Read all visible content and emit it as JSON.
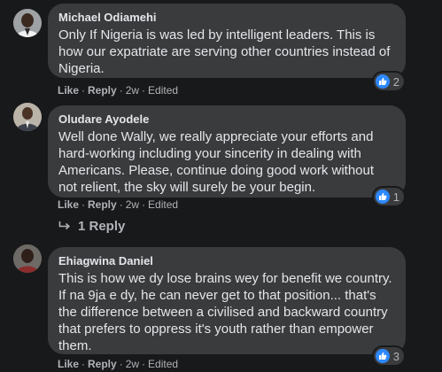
{
  "comments": [
    {
      "author": "Michael Odiamehi",
      "text": "Only If Nigeria is was led by intelligent leaders. This is how our expatriate are serving other countries instead of Nigeria.",
      "actions": {
        "like": "Like",
        "reply": "Reply",
        "time": "2w",
        "edited": "Edited"
      },
      "reaction_count": "2",
      "avatar_icon": "profile-photo"
    },
    {
      "author": "Oludare Ayodele",
      "text": "Well done Wally, we really appreciate your efforts and hard-working including your sincerity in dealing with Americans. Please, continue doing good work without not relient, the sky will surely be your begin.",
      "actions": {
        "like": "Like",
        "reply": "Reply",
        "time": "2w",
        "edited": "Edited"
      },
      "reaction_count": "1",
      "avatar_icon": "profile-photo"
    },
    {
      "author": "Ehiagwina Daniel",
      "text": "This is how we dy lose brains wey for benefit we country. If na 9ja e dy, he can never get to that position... that's the difference between a civilised and backward country that prefers to oppress it's youth rather than empower them.",
      "actions": {
        "like": "Like",
        "reply": "Reply",
        "time": "2w",
        "edited": "Edited"
      },
      "reaction_count": "3",
      "avatar_icon": "profile-photo"
    }
  ],
  "replies_link": {
    "label": "1 Reply",
    "icon": "reply-arrow-icon"
  },
  "colors": {
    "background": "#18191a",
    "bubble": "#3a3b3c",
    "primary_text": "#e4e6eb",
    "secondary_text": "#b0b3b8",
    "like_blue": "#2d88ff"
  }
}
